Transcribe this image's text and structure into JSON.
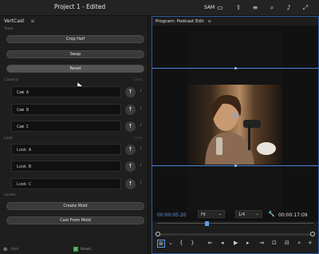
{
  "app": {
    "title": "Project 1 - Edited",
    "user": "SAM"
  },
  "left_panel": {
    "title": "VertCast",
    "menu_glyph": "≡",
    "sections": {
      "tools": "Tools",
      "camera": "Camera",
      "camera_right": "Clear",
      "look": "Look",
      "look_right": "Clear",
      "locker": "Locker"
    },
    "tool_buttons": [
      "Crop Half",
      "Swap",
      "Reset"
    ],
    "camera_fields": [
      "Cam A",
      "Cam B",
      "Cam C"
    ],
    "look_fields": [
      "Look A",
      "Look B",
      "Look C"
    ],
    "locker_buttons": [
      "Create Mold",
      "Cast From Mold"
    ],
    "footer": {
      "left": "Mall",
      "right": "Reset..."
    }
  },
  "program_panel": {
    "title": "Program: Podcast Edit",
    "menu_glyph": "≡",
    "timecode_current": "00:00:05:20",
    "fit": "Fit",
    "resolution": "1/4",
    "timecode_total": "00:00:17:09"
  },
  "colors": {
    "accent": "#4a86d8",
    "timecode_blue": "#5b9bf0"
  },
  "icons": [
    "sidebar-icon",
    "share-icon",
    "list-icon",
    "search-icon",
    "volume-icon",
    "expand-icon"
  ]
}
